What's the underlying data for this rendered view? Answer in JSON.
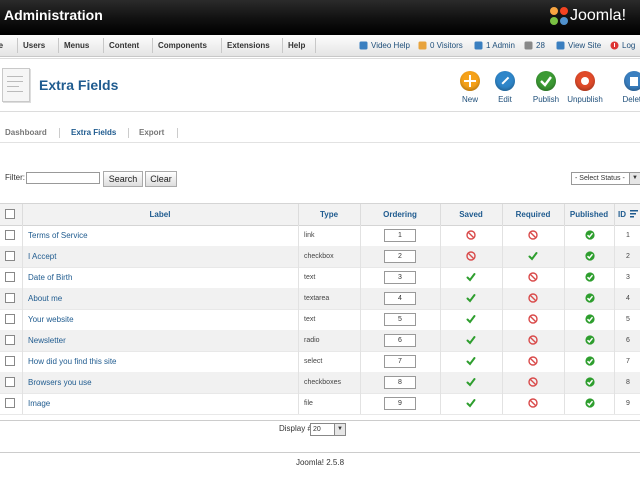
{
  "header": {
    "title": "Administration",
    "brand": "Joomla!"
  },
  "menu": {
    "items": [
      "te",
      "Users",
      "Menus",
      "Content",
      "Components",
      "Extensions",
      "Help"
    ]
  },
  "status": {
    "items": [
      "Video Help",
      "0 Visitors",
      "1 Admin",
      "28",
      "View Site",
      "Log o"
    ]
  },
  "page": {
    "title": "Extra Fields"
  },
  "toolbar": {
    "buttons": [
      "New",
      "Edit",
      "Publish",
      "Unpublish",
      "Delete"
    ]
  },
  "subnav": {
    "items": [
      "Dashboard",
      "Extra Fields",
      "Export"
    ],
    "active": 1
  },
  "filter": {
    "label": "Filter:",
    "value": "",
    "search": "Search",
    "clear": "Clear",
    "status": "- Select Status -"
  },
  "table": {
    "headers": [
      "Label",
      "Type",
      "Ordering",
      "Saved",
      "Required",
      "Published",
      "ID"
    ],
    "rows": [
      {
        "label": "Terms of Service",
        "type": "link",
        "ordering": "1",
        "saved": false,
        "required": false,
        "published": true,
        "id": "1"
      },
      {
        "label": "I Accept",
        "type": "checkbox",
        "ordering": "2",
        "saved": false,
        "required": true,
        "published": true,
        "id": "2"
      },
      {
        "label": "Date of Birth",
        "type": "text",
        "ordering": "3",
        "saved": true,
        "required": false,
        "published": true,
        "id": "3"
      },
      {
        "label": "About me",
        "type": "textarea",
        "ordering": "4",
        "saved": true,
        "required": false,
        "published": true,
        "id": "4"
      },
      {
        "label": "Your website",
        "type": "text",
        "ordering": "5",
        "saved": true,
        "required": false,
        "published": true,
        "id": "5"
      },
      {
        "label": "Newsletter",
        "type": "radio",
        "ordering": "6",
        "saved": true,
        "required": false,
        "published": true,
        "id": "6"
      },
      {
        "label": "How did you find this site",
        "type": "select",
        "ordering": "7",
        "saved": true,
        "required": false,
        "published": true,
        "id": "7"
      },
      {
        "label": "Browsers you use",
        "type": "checkboxes",
        "ordering": "8",
        "saved": true,
        "required": false,
        "published": true,
        "id": "8"
      },
      {
        "label": "Image",
        "type": "file",
        "ordering": "9",
        "saved": true,
        "required": false,
        "published": true,
        "id": "9"
      }
    ]
  },
  "footer": {
    "display_label": "Display #",
    "display_value": "20",
    "version": "Joomla! 2.5.8"
  },
  "colors": {
    "link": "#1f5b8f",
    "yes": "#2e9e2e",
    "no": "#d94a4a"
  }
}
